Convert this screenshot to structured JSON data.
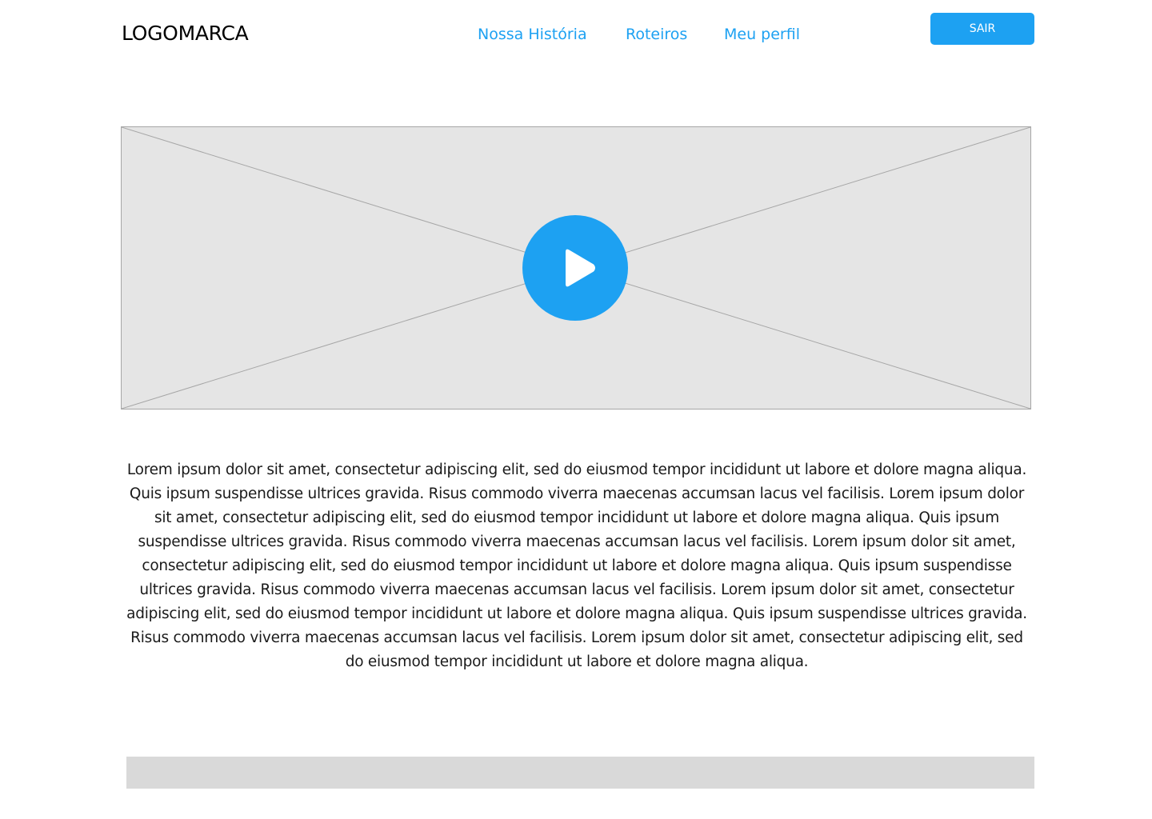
{
  "header": {
    "logo": "LOGOMARCA",
    "nav": [
      {
        "label": "Nossa História"
      },
      {
        "label": "Roteiros"
      },
      {
        "label": "Meu perfil"
      }
    ],
    "exit_label": "SAIR"
  },
  "video": {
    "placeholder_icon": "image-placeholder-cross-icon",
    "play_icon": "play-icon"
  },
  "content": {
    "paragraph": "Lorem ipsum dolor sit amet, consectetur adipiscing elit, sed do eiusmod tempor incididunt ut labore et dolore magna aliqua. Quis ipsum suspendisse ultrices gravida. Risus commodo viverra maecenas accumsan lacus vel facilisis. Lorem ipsum dolor sit amet, consectetur adipiscing elit, sed do eiusmod tempor incididunt ut labore et dolore magna aliqua. Quis ipsum suspendisse ultrices gravida. Risus commodo viverra maecenas accumsan lacus vel facilisis. Lorem ipsum dolor sit amet, consectetur adipiscing elit, sed do eiusmod tempor incididunt ut labore et dolore magna aliqua. Quis ipsum suspendisse ultrices gravida. Risus commodo viverra maecenas accumsan lacus vel facilisis. Lorem ipsum dolor sit amet, consectetur adipiscing elit, sed do eiusmod tempor incididunt ut labore et dolore magna aliqua. Quis ipsum suspendisse ultrices gravida. Risus commodo viverra maecenas accumsan lacus vel facilisis. Lorem ipsum dolor sit amet, consectetur adipiscing elit, sed do eiusmod tempor incididunt ut labore et dolore magna aliqua."
  },
  "colors": {
    "accent": "#1da1f2",
    "video_bg": "#e5e5e5",
    "video_lines": "#a6a6a6",
    "footer_bar": "#d9d9d9",
    "text": "#1a1a1a"
  }
}
